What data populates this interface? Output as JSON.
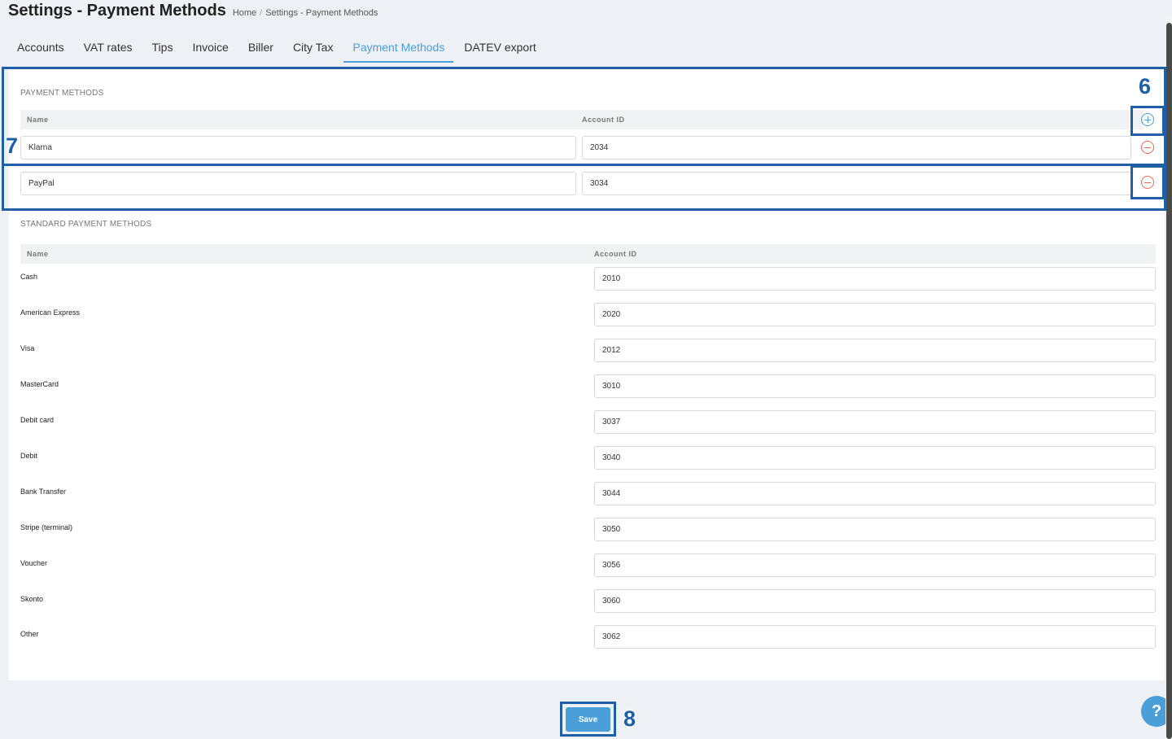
{
  "header": {
    "title": "Settings - Payment Methods",
    "breadcrumb": {
      "home": "Home",
      "separator": "/",
      "current": "Settings - Payment Methods"
    }
  },
  "tabs": [
    {
      "label": "Accounts",
      "active": false
    },
    {
      "label": "VAT rates",
      "active": false
    },
    {
      "label": "Tips",
      "active": false
    },
    {
      "label": "Invoice",
      "active": false
    },
    {
      "label": "Biller",
      "active": false
    },
    {
      "label": "City Tax",
      "active": false
    },
    {
      "label": "Payment Methods",
      "active": true
    },
    {
      "label": "DATEV export",
      "active": false
    }
  ],
  "payment_methods": {
    "section_label": "PAYMENT METHODS",
    "columns": {
      "name": "Name",
      "account_id": "Account ID"
    },
    "add_icon": "plus-circle-icon",
    "remove_icon": "minus-circle-icon",
    "rows": [
      {
        "name": "Klarna",
        "account_id": "2034"
      },
      {
        "name": "PayPal",
        "account_id": "3034"
      }
    ]
  },
  "standard_payment_methods": {
    "section_label": "STANDARD PAYMENT METHODS",
    "columns": {
      "name": "Name",
      "account_id": "Account ID"
    },
    "rows": [
      {
        "name": "Cash",
        "account_id": "2010"
      },
      {
        "name": "American Express",
        "account_id": "2020"
      },
      {
        "name": "Visa",
        "account_id": "2012"
      },
      {
        "name": "MasterCard",
        "account_id": "3010"
      },
      {
        "name": "Debit card",
        "account_id": "3037"
      },
      {
        "name": "Debit",
        "account_id": "3040"
      },
      {
        "name": "Bank Transfer",
        "account_id": "3044"
      },
      {
        "name": "Stripe (terminal)",
        "account_id": "3050"
      },
      {
        "name": "Voucher",
        "account_id": "3056"
      },
      {
        "name": "Skonto",
        "account_id": "3060"
      },
      {
        "name": "Other",
        "account_id": "3062"
      }
    ]
  },
  "save_label": "Save",
  "help_label": "?",
  "annotations": {
    "n6": "6",
    "n7": "7",
    "n8": "8"
  },
  "colors": {
    "accent": "#4a9fd8",
    "danger": "#e06b5f",
    "annotation": "#1f5fa8",
    "background": "#edf0f4"
  }
}
